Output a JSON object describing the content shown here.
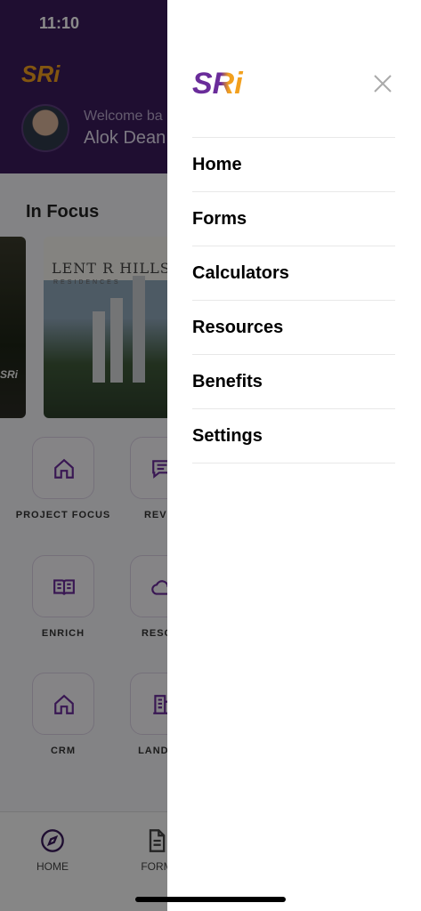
{
  "status_bar": {
    "time": "11:10"
  },
  "brand": {
    "logo_text": "SRi",
    "primary_color": "#6a2c9a",
    "accent_color": "#f2a01e"
  },
  "header": {
    "welcome": "Welcome ba",
    "user_name": "Alok Dean"
  },
  "in_focus": {
    "title": "In Focus",
    "cards": [
      {
        "overlay_text": "SRi"
      },
      {
        "title": "LENT R HILLS",
        "subtitle": "RESIDENCES"
      }
    ]
  },
  "quick_links": [
    {
      "label": "PROJECT FOCUS",
      "icon": "home-outline-icon"
    },
    {
      "label": "REVIE",
      "icon": "chat-icon"
    },
    {
      "label": "ENRICH",
      "icon": "open-book-icon"
    },
    {
      "label": "RESOU",
      "icon": "cloud-icon"
    },
    {
      "label": "CRM",
      "icon": "home-outline-icon"
    },
    {
      "label": "LANDSC",
      "icon": "building-icon"
    }
  ],
  "tab_bar": {
    "tabs": [
      {
        "label": "HOME",
        "icon": "compass-icon"
      },
      {
        "label": "FORM",
        "icon": "document-icon"
      }
    ]
  },
  "drawer": {
    "close_icon": "close-icon",
    "menu": [
      {
        "label": "Home"
      },
      {
        "label": "Forms"
      },
      {
        "label": "Calculators"
      },
      {
        "label": "Resources"
      },
      {
        "label": "Benefits"
      },
      {
        "label": "Settings"
      }
    ]
  }
}
